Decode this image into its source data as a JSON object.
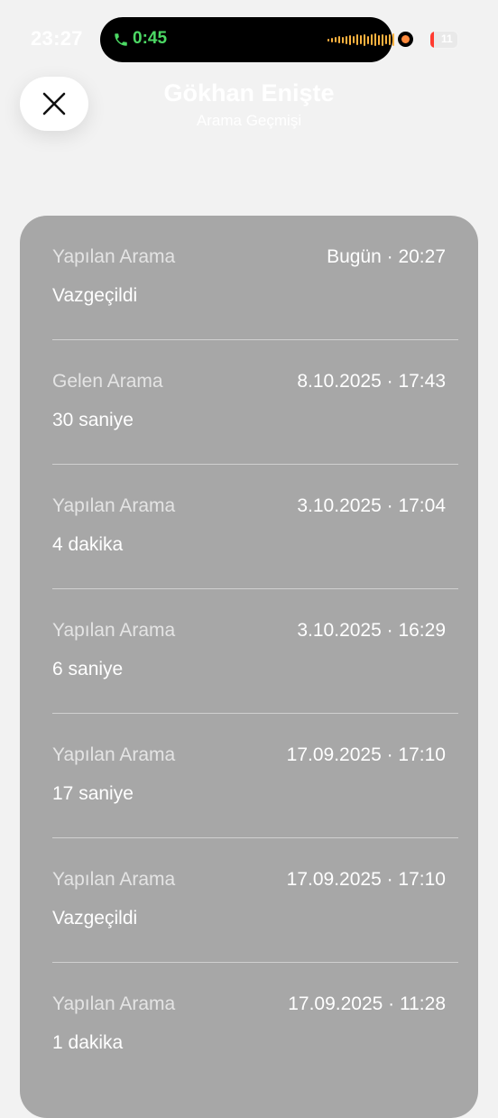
{
  "status_bar": {
    "time": "23:27",
    "call_timer": "0:45",
    "battery_level": "11",
    "icons": [
      "phone-icon",
      "waveform-icon",
      "recording-indicator-icon",
      "battery-icon"
    ],
    "colors": {
      "call_green": "#4cd964",
      "waveform_orange": "#ffb340",
      "battery_red": "#ff3b30"
    }
  },
  "header": {
    "close_icon": "close-icon",
    "contact_name": "Gökhan Enişte",
    "subtitle": "Arama Geçmişi"
  },
  "calls": [
    {
      "type": "Yapılan Arama",
      "date": "Bugün · 20:27",
      "detail": "Vazgeçildi"
    },
    {
      "type": "Gelen Arama",
      "date": "8.10.2025 · 17:43",
      "detail": "30 saniye"
    },
    {
      "type": "Yapılan Arama",
      "date": "3.10.2025 · 17:04",
      "detail": "4 dakika"
    },
    {
      "type": "Yapılan Arama",
      "date": "3.10.2025 · 16:29",
      "detail": "6 saniye"
    },
    {
      "type": "Yapılan Arama",
      "date": "17.09.2025 · 17:10",
      "detail": "17 saniye"
    },
    {
      "type": "Yapılan Arama",
      "date": "17.09.2025 · 17:10",
      "detail": "Vazgeçildi"
    },
    {
      "type": "Yapılan Arama",
      "date": "17.09.2025 · 11:28",
      "detail": "1 dakika"
    }
  ]
}
